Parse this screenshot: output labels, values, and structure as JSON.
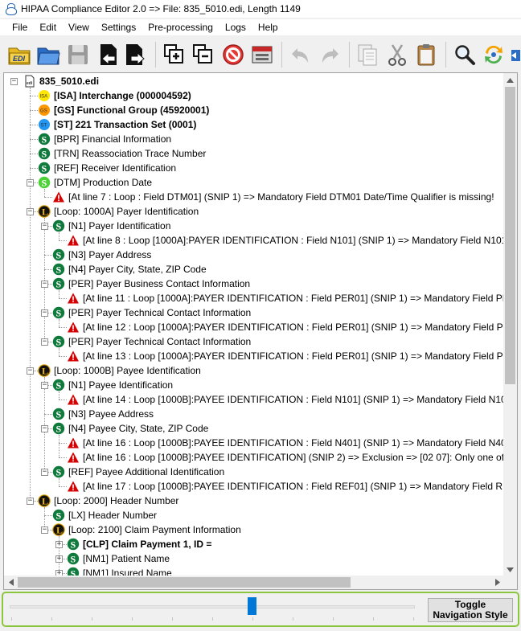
{
  "window": {
    "title": "HIPAA Compliance Editor 2.0 => File: 835_5010.edi, Length 1149"
  },
  "menu": {
    "items": [
      "File",
      "Edit",
      "View",
      "Settings",
      "Pre-processing",
      "Logs",
      "Help"
    ]
  },
  "toolbar": {
    "buttons": [
      "edi-file-icon",
      "open-folder-icon",
      "save-icon",
      "import-icon",
      "export-icon",
      "add-segment-icon",
      "remove-segment-icon",
      "stop-icon",
      "window-icon",
      "undo-icon",
      "redo-icon",
      "copy-icon",
      "cut-icon",
      "paste-icon",
      "find-icon",
      "refresh-icon",
      "scroll-icon"
    ]
  },
  "tree": {
    "rows": [
      {
        "level": 0,
        "icon": "file-icon",
        "label": "835_5010.edi",
        "bold": true,
        "expander": "-"
      },
      {
        "level": 1,
        "icon": "isa-icon",
        "label": "[ISA] Interchange (000004592)",
        "bold": true
      },
      {
        "level": 1,
        "icon": "gs-icon",
        "label": "[GS] Functional Group (45920001)",
        "bold": true
      },
      {
        "level": 1,
        "icon": "st-icon",
        "label": "[ST] 221 Transaction Set (0001)",
        "bold": true
      },
      {
        "level": 1,
        "icon": "segment-icon",
        "label": "[BPR] Financial Information"
      },
      {
        "level": 1,
        "icon": "segment-icon",
        "label": "[TRN] Reassociation Trace Number"
      },
      {
        "level": 1,
        "icon": "segment-icon",
        "label": "[REF] Receiver Identification"
      },
      {
        "level": 1,
        "icon": "segment-green-icon",
        "label": "[DTM] Production Date",
        "expander": "-"
      },
      {
        "level": 2,
        "icon": "warning-icon",
        "label": "[At line 7 : Loop  : Field DTM01] (SNIP 1) => Mandatory Field DTM01 Date/Time Qualifier is missing!"
      },
      {
        "level": 1,
        "icon": "loop-icon",
        "label": "[Loop: 1000A] Payer Identification",
        "expander": "-"
      },
      {
        "level": 2,
        "icon": "segment-icon",
        "label": "[N1] Payer Identification",
        "expander": "-"
      },
      {
        "level": 3,
        "icon": "warning-icon",
        "label": "[At line 8 : Loop [1000A]:PAYER IDENTIFICATION : Field N101] (SNIP 1) => Mandatory Field N101"
      },
      {
        "level": 2,
        "icon": "segment-icon",
        "label": "[N3] Payer Address"
      },
      {
        "level": 2,
        "icon": "segment-icon",
        "label": "[N4] Payer City, State, ZIP Code"
      },
      {
        "level": 2,
        "icon": "segment-icon",
        "label": "[PER] Payer Business Contact Information",
        "expander": "-"
      },
      {
        "level": 3,
        "icon": "warning-icon",
        "label": "[At line 11 : Loop [1000A]:PAYER IDENTIFICATION : Field PER01] (SNIP 1) => Mandatory Field PE"
      },
      {
        "level": 2,
        "icon": "segment-icon",
        "label": "[PER] Payer Technical Contact Information",
        "expander": "-"
      },
      {
        "level": 3,
        "icon": "warning-icon",
        "label": "[At line 12 : Loop [1000A]:PAYER IDENTIFICATION : Field PER01] (SNIP 1) => Mandatory Field PE"
      },
      {
        "level": 2,
        "icon": "segment-icon",
        "label": "[PER] Payer Technical Contact Information",
        "expander": "-"
      },
      {
        "level": 3,
        "icon": "warning-icon",
        "label": "[At line 13 : Loop [1000A]:PAYER IDENTIFICATION : Field PER01] (SNIP 1) => Mandatory Field PE"
      },
      {
        "level": 1,
        "icon": "loop-icon",
        "label": "[Loop: 1000B] Payee Identification",
        "expander": "-"
      },
      {
        "level": 2,
        "icon": "segment-icon",
        "label": "[N1] Payee Identification",
        "expander": "-"
      },
      {
        "level": 3,
        "icon": "warning-icon",
        "label": "[At line 14 : Loop [1000B]:PAYEE IDENTIFICATION : Field N101] (SNIP 1) => Mandatory Field N10"
      },
      {
        "level": 2,
        "icon": "segment-icon",
        "label": "[N3] Payee Address"
      },
      {
        "level": 2,
        "icon": "segment-icon",
        "label": "[N4] Payee City, State, ZIP Code",
        "expander": "-"
      },
      {
        "level": 3,
        "icon": "warning-icon",
        "label": "[At line 16 : Loop [1000B]:PAYEE IDENTIFICATION : Field N401] (SNIP 1) => Mandatory Field N40"
      },
      {
        "level": 3,
        "icon": "warning-icon",
        "label": "[At line 16 : Loop [1000B]:PAYEE IDENTIFICATION] (SNIP 2) => Exclusion => [02 07]: Only one of"
      },
      {
        "level": 2,
        "icon": "segment-icon",
        "label": "[REF] Payee Additional Identification",
        "expander": "-"
      },
      {
        "level": 3,
        "icon": "warning-icon",
        "label": "[At line 17 : Loop [1000B]:PAYEE IDENTIFICATION : Field REF01] (SNIP 1) => Mandatory Field RE"
      },
      {
        "level": 1,
        "icon": "loop-icon",
        "label": "[Loop: 2000] Header Number",
        "expander": "-"
      },
      {
        "level": 2,
        "icon": "segment-icon",
        "label": "[LX] Header Number"
      },
      {
        "level": 2,
        "icon": "loop-icon",
        "label": "[Loop: 2100] Claim Payment Information",
        "expander": "-"
      },
      {
        "level": 3,
        "icon": "segment-icon",
        "label": "[CLP] Claim Payment  1,  ID =",
        "bold": true,
        "expander": "+"
      },
      {
        "level": 3,
        "icon": "segment-icon",
        "label": "[NM1] Patient Name",
        "expander": "+"
      },
      {
        "level": 3,
        "icon": "segment-icon",
        "label": "[NM1] Insured Name",
        "expander": "+"
      }
    ]
  },
  "navigation": {
    "toggle_line1": "Toggle",
    "toggle_line2": "Navigation Style",
    "slider_position": 0.6
  },
  "colors": {
    "accent_green": "#8cc63f",
    "segment_green": "#0f7a3c",
    "warning_red": "#d50000",
    "slider_blue": "#0078d7"
  }
}
